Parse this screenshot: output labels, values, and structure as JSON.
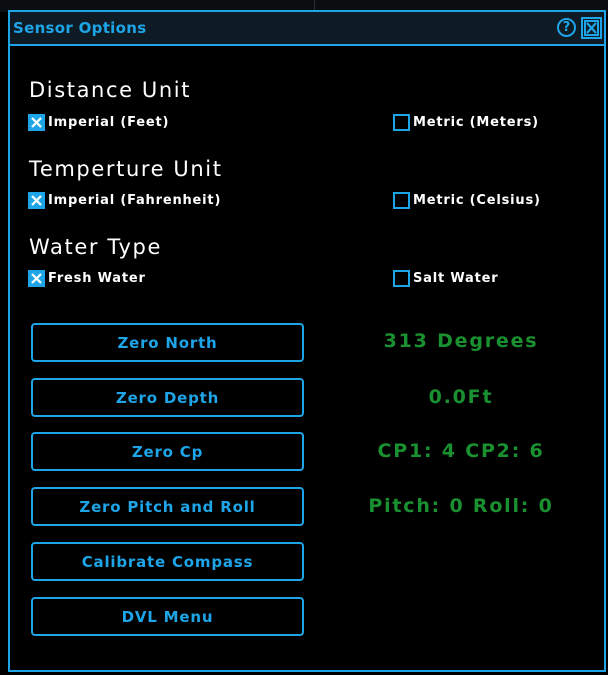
{
  "window": {
    "title": "Sensor Options",
    "help_glyph": "?",
    "help_icon": "question-circle-icon",
    "close_icon": "close-x-icon"
  },
  "colors": {
    "accent": "#1ea5e8",
    "readout": "#1a9130",
    "background": "#000000",
    "title_bar": "#0e1b24",
    "text": "#ffffff"
  },
  "sections": [
    {
      "heading": "Distance Unit",
      "options": [
        {
          "label": "Imperial (Feet)",
          "checked": true
        },
        {
          "label": "Metric (Meters)",
          "checked": false
        }
      ]
    },
    {
      "heading": "Temperture Unit",
      "options": [
        {
          "label": "Imperial (Fahrenheit)",
          "checked": true
        },
        {
          "label": "Metric (Celsius)",
          "checked": false
        }
      ]
    },
    {
      "heading": "Water Type",
      "options": [
        {
          "label": "Fresh Water",
          "checked": true
        },
        {
          "label": "Salt Water",
          "checked": false
        }
      ]
    }
  ],
  "actions": [
    {
      "label": "Zero North",
      "readout": "313 Degrees"
    },
    {
      "label": "Zero Depth",
      "readout": "0.0Ft"
    },
    {
      "label": "Zero Cp",
      "readout": "CP1: 4 CP2: 6"
    },
    {
      "label": "Zero Pitch and Roll",
      "readout": "Pitch: 0 Roll: 0"
    },
    {
      "label": "Calibrate Compass",
      "readout": ""
    },
    {
      "label": "DVL Menu",
      "readout": ""
    }
  ]
}
